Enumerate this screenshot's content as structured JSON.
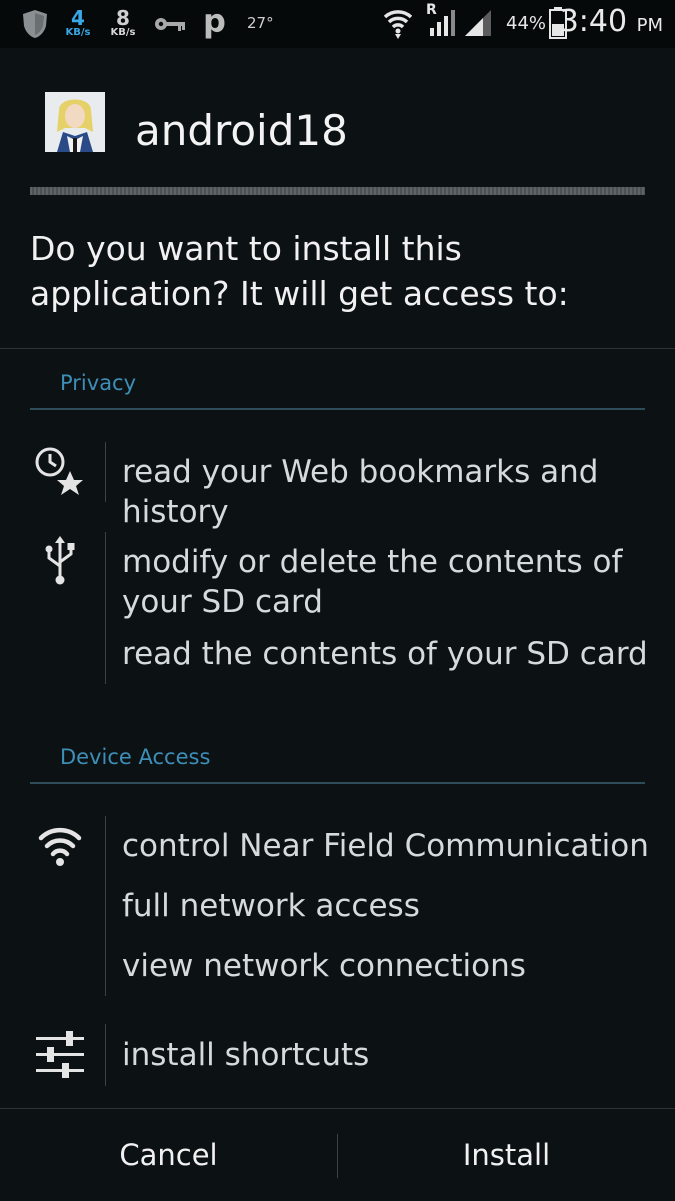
{
  "status_bar": {
    "net_down": "4",
    "net_down_unit": "KB/s",
    "net_up": "8",
    "net_up_unit": "KB/s",
    "temperature": "27°",
    "roaming": "R",
    "battery": "44%",
    "time": "3:40",
    "ampm": "PM"
  },
  "header": {
    "app_name": "android18",
    "prompt": "Do you want to install this application? It will get access to:"
  },
  "sections": [
    {
      "title": "Privacy",
      "groups": [
        {
          "icon": "bookmark-history-icon",
          "permissions": [
            "read your Web bookmarks and history"
          ]
        },
        {
          "icon": "usb-storage-icon",
          "permissions": [
            "modify or delete the contents of your SD card",
            "read the contents of your SD card"
          ]
        }
      ]
    },
    {
      "title": "Device Access",
      "groups": [
        {
          "icon": "wifi-network-icon",
          "permissions": [
            "control Near Field Communication",
            "full network access",
            "view network connections"
          ]
        },
        {
          "icon": "settings-sliders-icon",
          "permissions": [
            "install shortcuts"
          ]
        }
      ]
    }
  ],
  "buttons": {
    "cancel": "Cancel",
    "install": "Install"
  },
  "colors": {
    "background": "#0c1113",
    "section_accent": "#3d8fb8",
    "network_speed": "#3aa7e6"
  }
}
